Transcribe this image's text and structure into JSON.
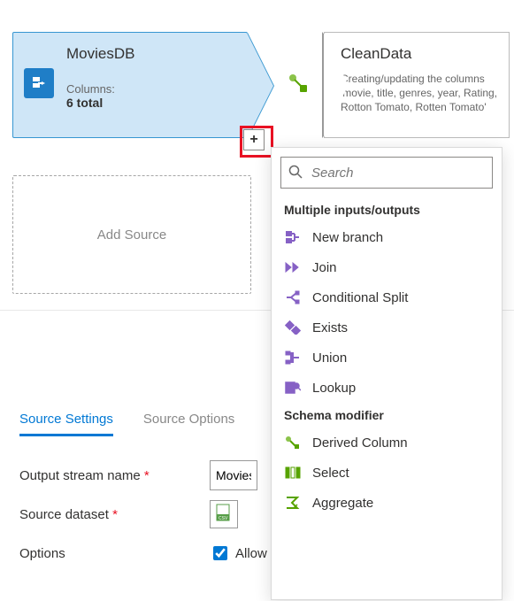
{
  "canvas": {
    "source": {
      "title": "MoviesDB",
      "columns_label": "Columns:",
      "columns_value": "6 total",
      "plus_label": "+"
    },
    "clean": {
      "title": "CleanData",
      "desc": "Creating/updating the columns 'movie, title, genres, year, Rating, Rotton Tomato, Rotten Tomato'"
    },
    "add_source_label": "Add Source"
  },
  "settings": {
    "tabs": [
      "Source Settings",
      "Source Options"
    ],
    "output_stream_label": "Output stream name",
    "output_stream_value": "MoviesDB",
    "source_dataset_label": "Source dataset",
    "options_label": "Options",
    "option_checkbox_label": "Allow schema drift"
  },
  "popup": {
    "search_placeholder": "Search",
    "section1": "Multiple inputs/outputs",
    "items1": [
      "New branch",
      "Join",
      "Conditional Split",
      "Exists",
      "Union",
      "Lookup"
    ],
    "section2": "Schema modifier",
    "items2": [
      "Derived Column",
      "Select",
      "Aggregate"
    ]
  },
  "icons": {
    "source": "database-arrow-icon",
    "clean": "derive-icon",
    "plus": "plus-icon",
    "search": "search-icon",
    "dataset": "csv-file-icon"
  },
  "colors": {
    "accent": "#0078d4",
    "highlight": "#e81123",
    "brand_purple": "#8661c5",
    "brand_green": "#57a300"
  }
}
